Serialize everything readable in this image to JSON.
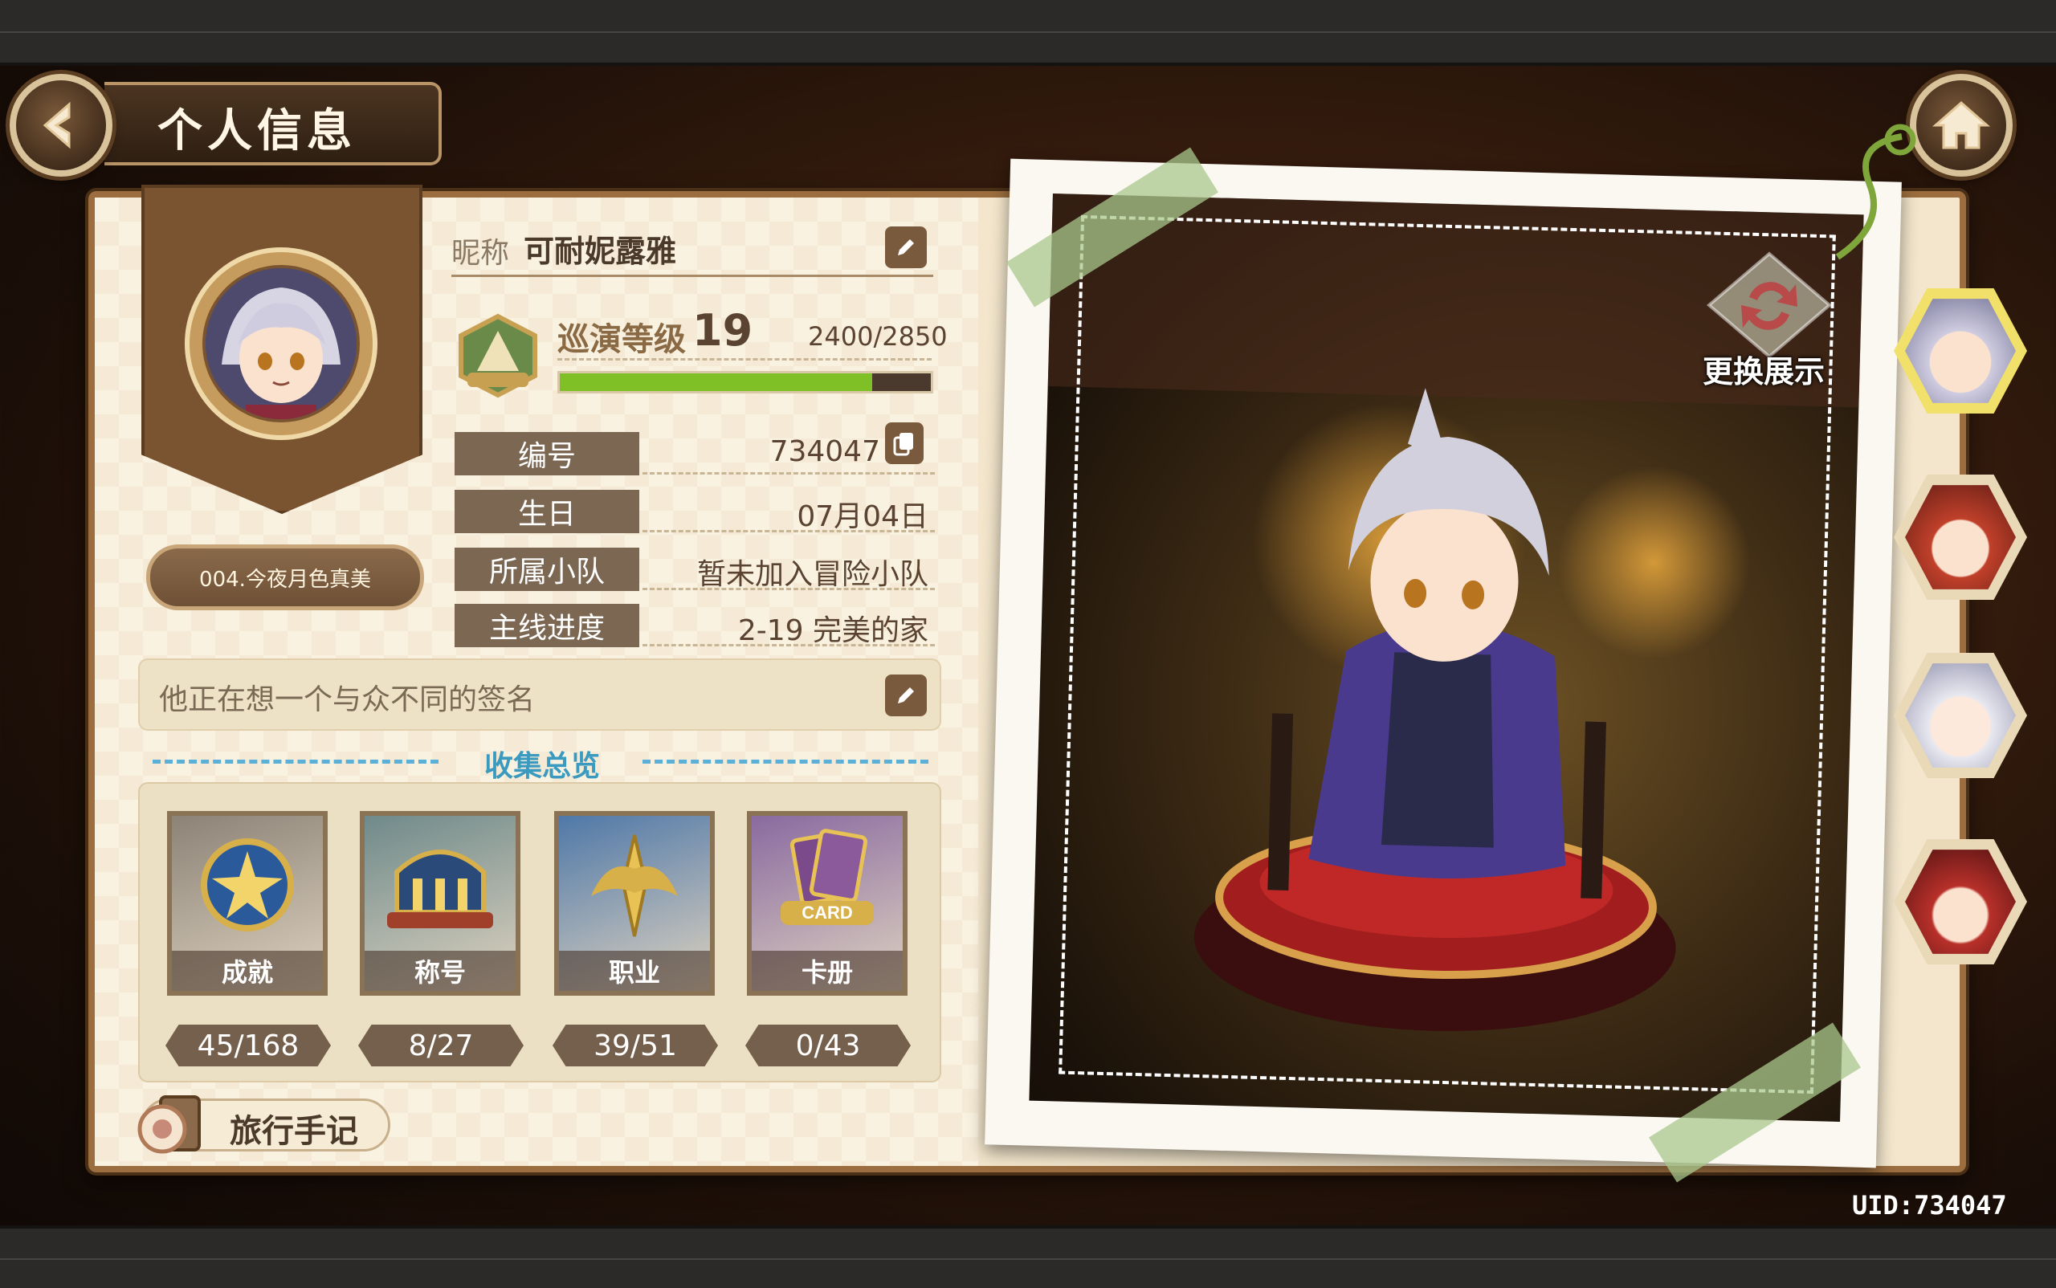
{
  "header": {
    "title": "个人信息"
  },
  "profile": {
    "nickname_label": "昵称",
    "nickname": "可耐妮露雅",
    "level_label": "巡演等级",
    "level": "19",
    "exp_text": "2400/2850",
    "exp_progress": 0.842,
    "title_plate": "004.今夜月色真美",
    "rows": [
      {
        "label": "编号",
        "value": "734047"
      },
      {
        "label": "生日",
        "value": "07月04日"
      },
      {
        "label": "所属小队",
        "value": "暂未加入冒险小队"
      },
      {
        "label": "主线进度",
        "value": "2-19 完美的家"
      }
    ],
    "signature": "他正在想一个与众不同的签名"
  },
  "collection": {
    "title": "收集总览",
    "items": [
      {
        "label": "成就",
        "count": "45/168",
        "color": "#8c8276"
      },
      {
        "label": "称号",
        "count": "8/27",
        "color": "#6f8a8a"
      },
      {
        "label": "职业",
        "count": "39/51",
        "color": "#4f78a8"
      },
      {
        "label": "卡册",
        "count": "0/43",
        "color": "#8a6aa0",
        "emblem_text": "CARD"
      }
    ]
  },
  "travel": {
    "label": "旅行手记"
  },
  "showcase": {
    "swap_label": "更换展示"
  },
  "footer": {
    "uid": "UID:734047"
  },
  "icons": [
    "back-arrow-icon",
    "home-icon",
    "edit-icon",
    "copy-icon",
    "swap-icon",
    "journal-icon"
  ]
}
